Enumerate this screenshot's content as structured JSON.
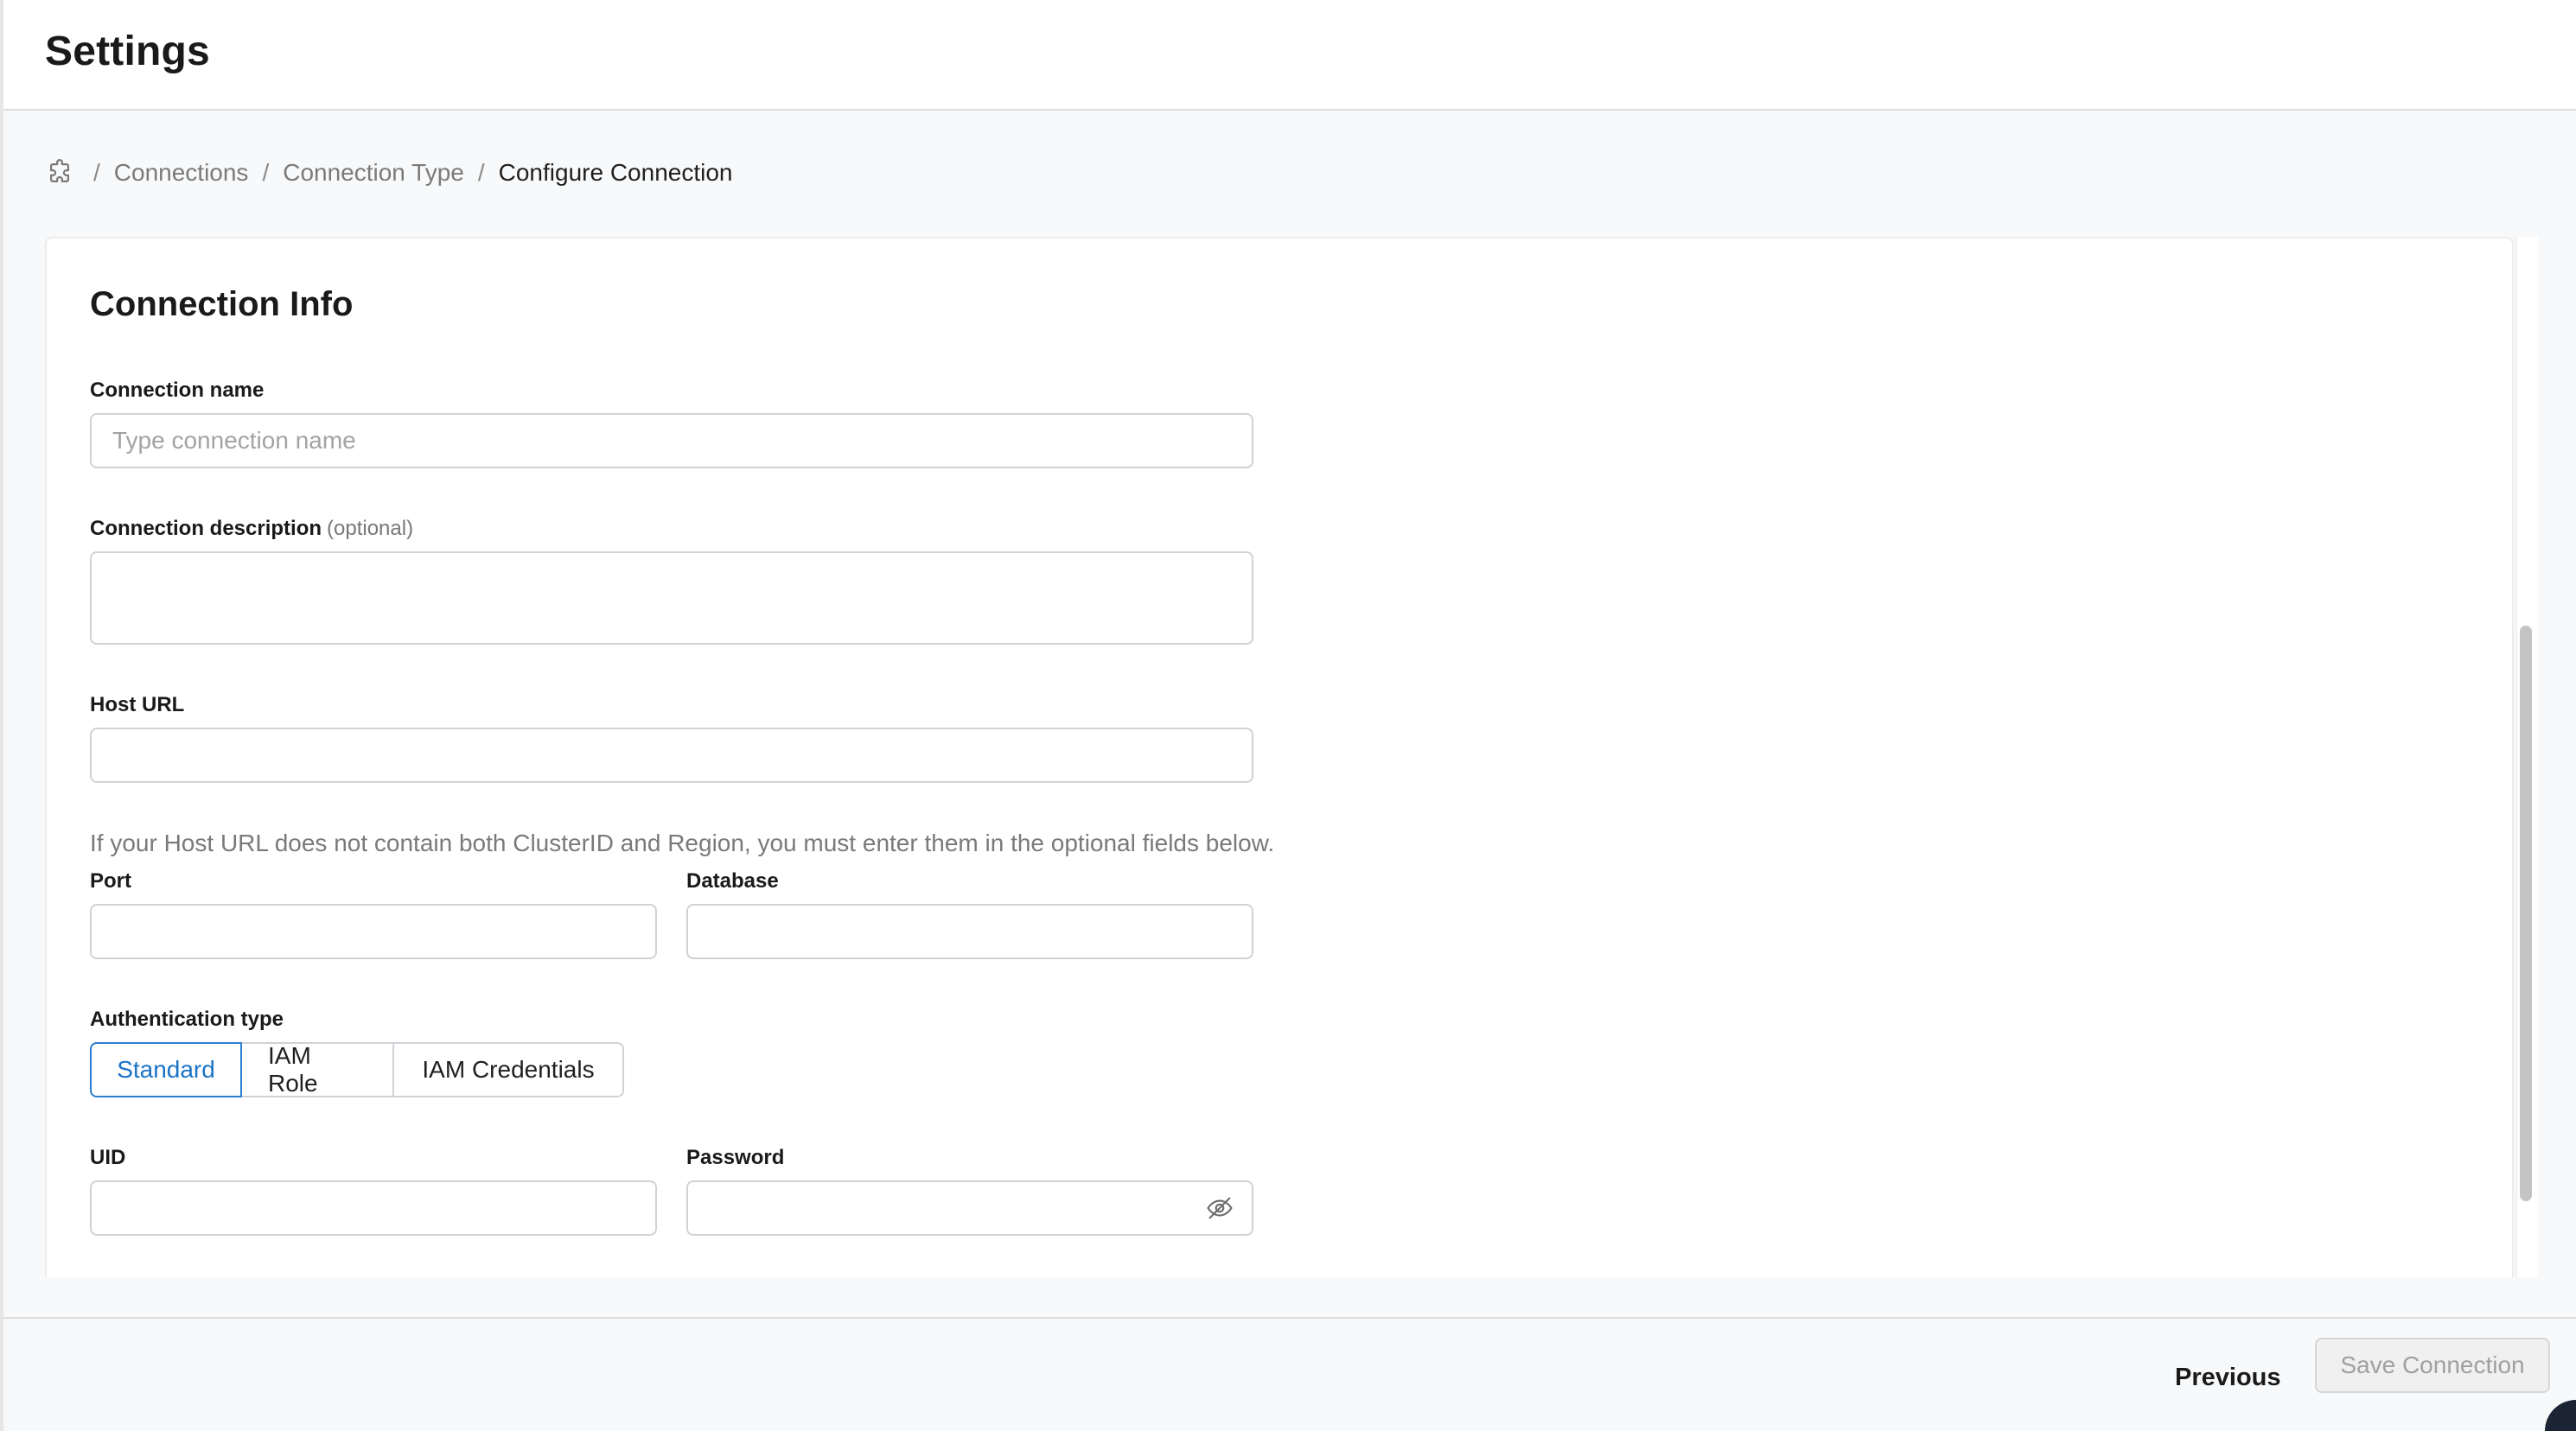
{
  "header": {
    "title": "Settings"
  },
  "breadcrumb": {
    "icon": "puzzle-icon",
    "items": [
      "Connections",
      "Connection Type",
      "Configure Connection"
    ],
    "separator": "/"
  },
  "form": {
    "section_title": "Connection Info",
    "connection_name": {
      "label": "Connection name",
      "placeholder": "Type connection name",
      "value": ""
    },
    "connection_description": {
      "label": "Connection description",
      "optional": "(optional)",
      "value": ""
    },
    "host_url": {
      "label": "Host URL",
      "value": ""
    },
    "hint": "If your Host URL does not contain both ClusterID and Region, you must enter them in the optional fields below.",
    "port": {
      "label": "Port",
      "value": ""
    },
    "database": {
      "label": "Database",
      "value": ""
    },
    "auth": {
      "label": "Authentication type",
      "options": [
        "Standard",
        "IAM Role",
        "IAM Credentials"
      ],
      "selected": "Standard"
    },
    "uid": {
      "label": "UID",
      "value": ""
    },
    "password": {
      "label": "Password",
      "value": "",
      "toggle_icon": "eye-off-icon"
    }
  },
  "footer": {
    "previous_label": "Previous",
    "save_label": "Save Connection"
  },
  "colors": {
    "accent": "#2b7fd1",
    "border": "#cfd3d7",
    "muted": "#7a7a7a"
  }
}
